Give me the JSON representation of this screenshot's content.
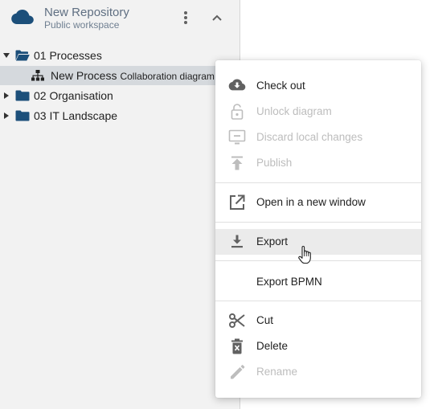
{
  "repository": {
    "title": "New Repository",
    "subtitle": "Public workspace",
    "cloud_icon": "cloud-icon",
    "more_icon": "more-vertical-icon",
    "collapse_icon": "chevron-up-icon"
  },
  "tree": {
    "items": [
      {
        "label": "01 Processes",
        "icon": "folder-open-icon",
        "expanded": true
      },
      {
        "label": "New Process",
        "sublabel": "Collaboration diagram ...",
        "icon": "sitemap-icon",
        "selected": true
      },
      {
        "label": "02 Organisation",
        "icon": "folder-icon",
        "expanded": false
      },
      {
        "label": "03 IT Landscape",
        "icon": "folder-icon",
        "expanded": false
      }
    ]
  },
  "context_menu": {
    "items": [
      {
        "label": "Check out",
        "icon": "cloud-download-icon",
        "enabled": true
      },
      {
        "label": "Unlock diagram",
        "icon": "unlock-icon",
        "enabled": false
      },
      {
        "label": "Discard local changes",
        "icon": "discard-icon",
        "enabled": false
      },
      {
        "label": "Publish",
        "icon": "publish-icon",
        "enabled": false
      },
      {
        "label": "Open in a new window",
        "icon": "open-in-new-icon",
        "enabled": true
      },
      {
        "label": "Export",
        "icon": "download-icon",
        "enabled": true,
        "hovered": true
      },
      {
        "label": "Export BPMN",
        "icon": "",
        "enabled": true
      },
      {
        "label": "Cut",
        "icon": "scissors-icon",
        "enabled": true
      },
      {
        "label": "Delete",
        "icon": "trash-icon",
        "enabled": true
      },
      {
        "label": "Rename",
        "icon": "pencil-icon",
        "enabled": false
      }
    ]
  },
  "colors": {
    "folder": "#1c4f7a",
    "accent": "#1c4f7a",
    "selected_row": "#d5d9dd",
    "hover_row": "#ebebeb",
    "disabled_text": "#bdbdbd"
  }
}
